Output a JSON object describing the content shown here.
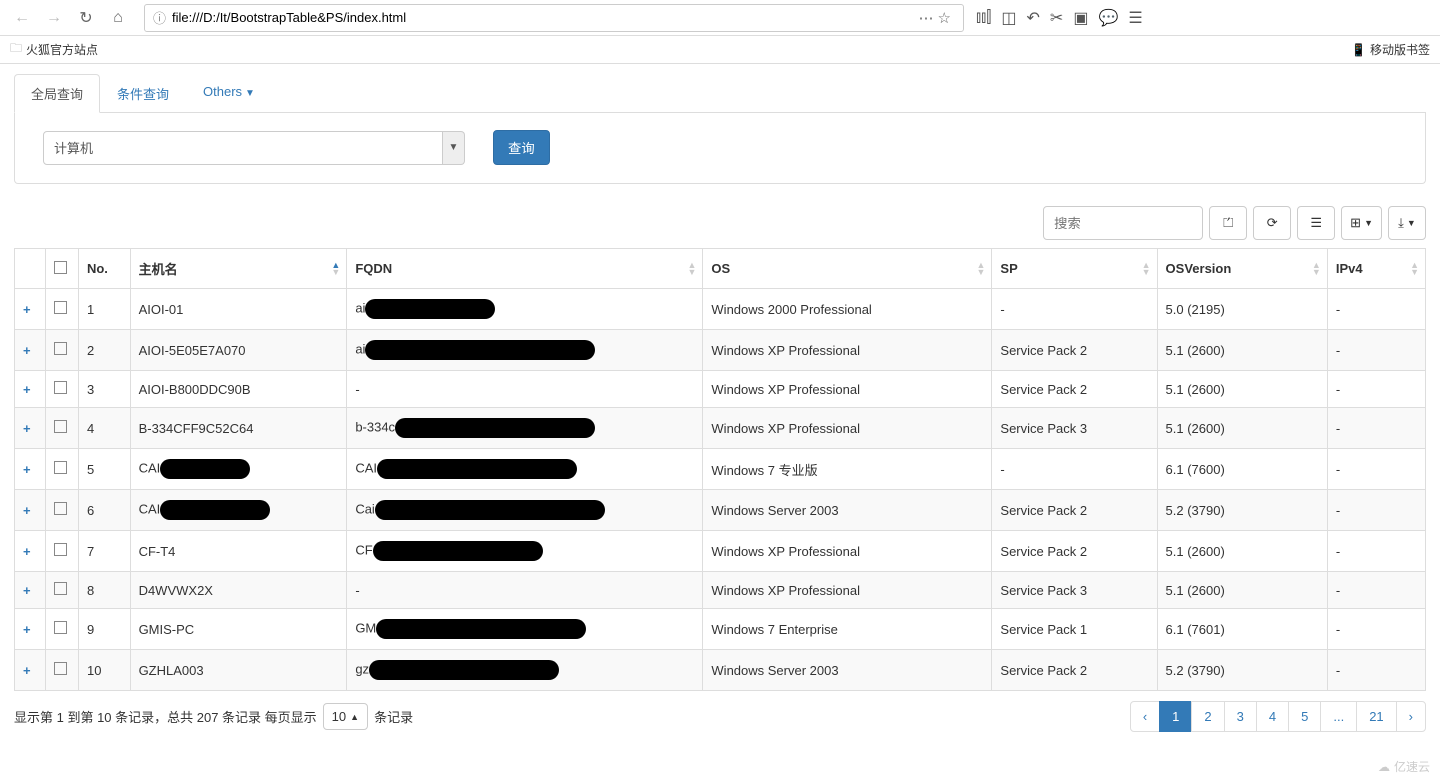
{
  "browser": {
    "url": "file:///D:/It/BootstrapTable&PS/index.html",
    "bookmark_folder": "火狐官方站点",
    "mobile_bookmarks": "移动版书签"
  },
  "tabs": {
    "global_query": "全局查询",
    "condition_query": "条件查询",
    "others": "Others"
  },
  "filter": {
    "select_value": "计算机",
    "query_btn": "查询"
  },
  "search": {
    "placeholder": "搜索"
  },
  "columns": {
    "no": "No.",
    "host": "主机名",
    "fqdn": "FQDN",
    "os": "OS",
    "sp": "SP",
    "osv": "OSVersion",
    "ipv4": "IPv4"
  },
  "rows": [
    {
      "no": "1",
      "host": "AIOI-01",
      "fqdn": "ai",
      "fqdn_redact_w": 130,
      "os": "Windows 2000 Professional",
      "sp": "-",
      "osv": "5.0 (2195)",
      "ipv4": "-"
    },
    {
      "no": "2",
      "host": "AIOI-5E05E7A070",
      "fqdn": "ai",
      "fqdn_redact_w": 230,
      "os": "Windows XP Professional",
      "sp": "Service Pack 2",
      "osv": "5.1 (2600)",
      "ipv4": "-"
    },
    {
      "no": "3",
      "host": "AIOI-B800DDC90B",
      "fqdn": "-",
      "fqdn_redact_w": 0,
      "os": "Windows XP Professional",
      "sp": "Service Pack 2",
      "osv": "5.1 (2600)",
      "ipv4": "-"
    },
    {
      "no": "4",
      "host": "B-334CFF9C52C64",
      "fqdn": "b-334c",
      "fqdn_redact_w": 200,
      "host_redact_w": 0,
      "os": "Windows XP Professional",
      "sp": "Service Pack 3",
      "osv": "5.1 (2600)",
      "ipv4": "-"
    },
    {
      "no": "5",
      "host": "CAI",
      "host_redact_w": 90,
      "fqdn": "CAI",
      "fqdn_redact_w": 200,
      "os": "Windows 7 专业版",
      "sp": "-",
      "osv": "6.1 (7600)",
      "ipv4": "-"
    },
    {
      "no": "6",
      "host": "CAI",
      "host_redact_w": 110,
      "fqdn": "Cai",
      "fqdn_redact_w": 230,
      "os": "Windows Server 2003",
      "sp": "Service Pack 2",
      "osv": "5.2 (3790)",
      "ipv4": "-"
    },
    {
      "no": "7",
      "host": "CF-T4",
      "fqdn": "CF",
      "fqdn_redact_w": 170,
      "os": "Windows XP Professional",
      "sp": "Service Pack 2",
      "osv": "5.1 (2600)",
      "ipv4": "-"
    },
    {
      "no": "8",
      "host": "D4WVWX2X",
      "fqdn": "-",
      "fqdn_redact_w": 0,
      "os": "Windows XP Professional",
      "sp": "Service Pack 3",
      "osv": "5.1 (2600)",
      "ipv4": "-"
    },
    {
      "no": "9",
      "host": "GMIS-PC",
      "fqdn": "GM",
      "fqdn_redact_w": 210,
      "os": "Windows 7 Enterprise",
      "sp": "Service Pack 1",
      "osv": "6.1 (7601)",
      "ipv4": "-"
    },
    {
      "no": "10",
      "host": "GZHLA003",
      "fqdn": "gz",
      "fqdn_redact_w": 190,
      "os": "Windows Server 2003",
      "sp": "Service Pack 2",
      "osv": "5.2 (3790)",
      "ipv4": "-"
    }
  ],
  "footer": {
    "info_prefix": "显示第 1 到第 10 条记录，总共 207 条记录 每页显示",
    "page_size": "10",
    "info_suffix": "条记录",
    "pages": [
      "‹",
      "1",
      "2",
      "3",
      "4",
      "5",
      "...",
      "21",
      "›"
    ],
    "active_page": "1"
  },
  "watermark": "亿速云"
}
